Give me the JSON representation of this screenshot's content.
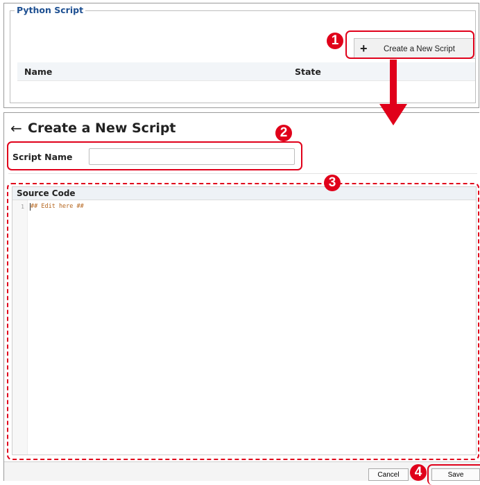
{
  "python_script_panel": {
    "legend": "Python Script",
    "create_button_label": "Create a New Script",
    "create_button_icon": "+",
    "table_columns": [
      "Name",
      "State"
    ]
  },
  "editor_page": {
    "back_icon": "←",
    "title": "Create a New Script",
    "script_name_label": "Script Name",
    "script_name_value": "",
    "source_code_label": "Source Code",
    "code_lines": [
      {
        "number": "1",
        "text": "## Edit here ##"
      }
    ],
    "cancel_label": "Cancel",
    "save_label": "Save"
  },
  "annotations": {
    "color": "#e0001a",
    "steps": [
      "1",
      "2",
      "3",
      "4"
    ]
  }
}
